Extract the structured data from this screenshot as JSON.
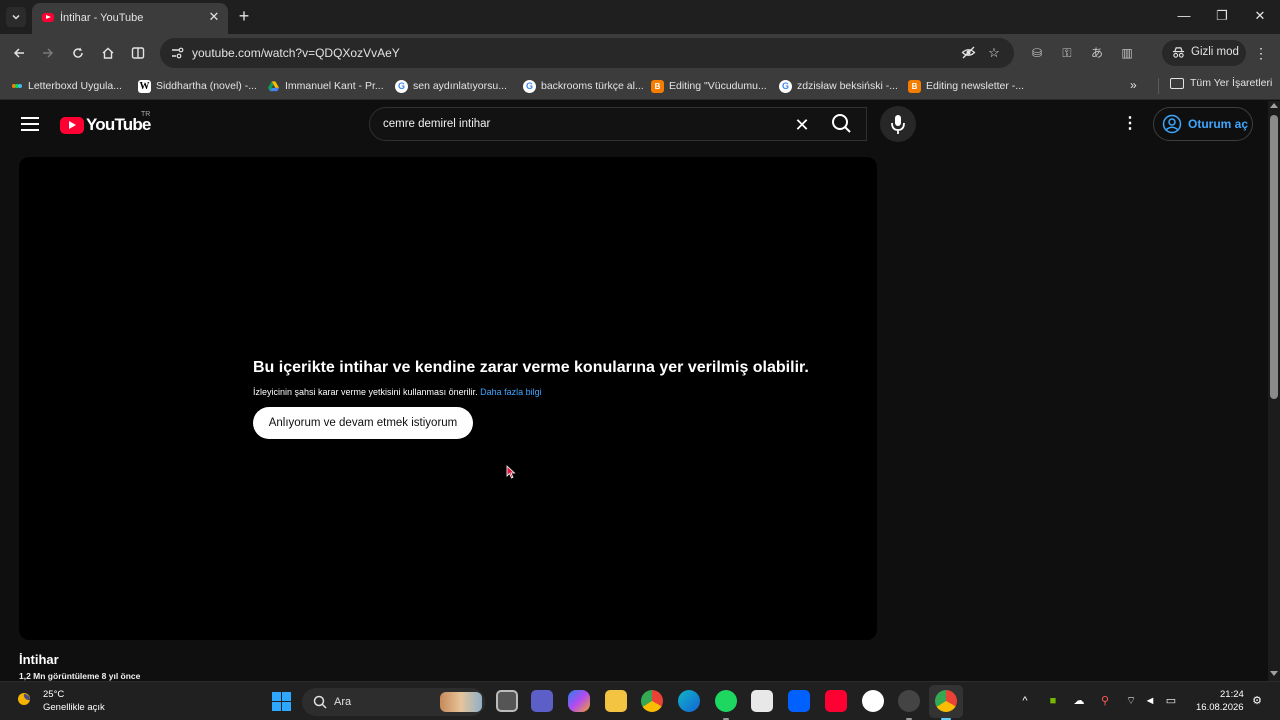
{
  "browser": {
    "tab": {
      "title": "İntihar - YouTube"
    },
    "url": "youtube.com/watch?v=QDQXozVvAeY",
    "incognito_label": "Gizli mod",
    "bookmarks": [
      {
        "label": "Letterboxd Uygula...",
        "icon": "letterboxd-icon"
      },
      {
        "label": "Siddhartha (novel) -...",
        "icon": "wikipedia-icon"
      },
      {
        "label": "Immanuel Kant - Pr...",
        "icon": "drive-icon"
      },
      {
        "label": "sen aydınlatıyorsu...",
        "icon": "google-icon"
      },
      {
        "label": "backrooms türkçe al...",
        "icon": "google-icon"
      },
      {
        "label": "Editing \"Vücudumu...",
        "icon": "blogger-icon"
      },
      {
        "label": "zdzisław beksiński -...",
        "icon": "google-icon"
      },
      {
        "label": "Editing newsletter -...",
        "icon": "blogger-icon"
      }
    ],
    "all_bookmarks_label": "Tüm Yer İşaretleri"
  },
  "youtube": {
    "region": "TR",
    "logo_text": "YouTube",
    "search_query": "cemre demirel intihar",
    "signin_label": "Oturum aç",
    "warning": {
      "title": "Bu içerikte intihar ve kendine zarar verme konularına yer verilmiş olabilir.",
      "subtitle": "İzleyicinin şahsi karar verme yetkisini kullanması önerilir.",
      "link": "Daha fazla bilgi",
      "button": "Anlıyorum ve devam etmek istiyorum"
    },
    "video": {
      "title": "İntihar",
      "meta": "1,2 Mn görüntüleme  8 yıl önce"
    }
  },
  "taskbar": {
    "weather_temp": "25°C",
    "weather_desc": "Genellikle açık",
    "search_label": "Ara",
    "time": "21:24",
    "date": "16.08.2026"
  },
  "colors": {
    "accent_link": "#3ea6ff",
    "youtube_red": "#ff0033",
    "page_bg": "#0f0f0f"
  }
}
